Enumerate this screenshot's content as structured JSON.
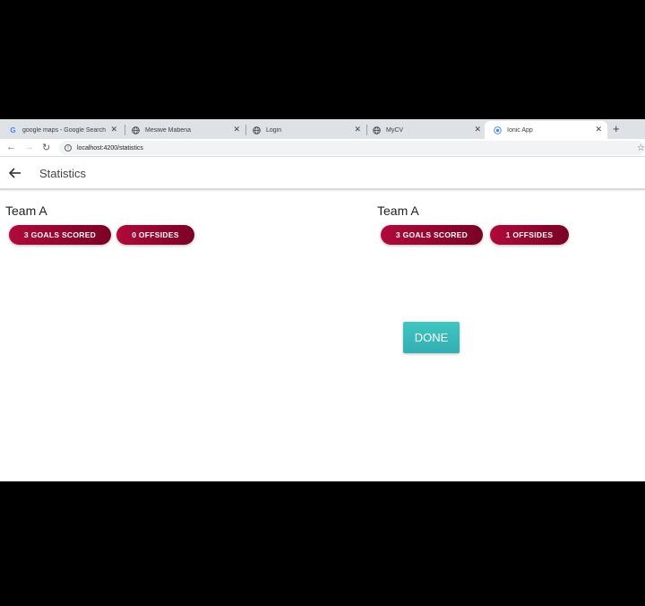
{
  "browser": {
    "tabs": [
      {
        "title": "google maps - Google Search",
        "favicon": "G"
      },
      {
        "title": "Mesiwe Mabena",
        "favicon": "globe"
      },
      {
        "title": "Login",
        "favicon": "globe"
      },
      {
        "title": "MyCV",
        "favicon": "globe"
      },
      {
        "title": "Ionic App",
        "favicon": "ionic",
        "active": true
      }
    ],
    "url": "localhost:4200/statistics"
  },
  "header": {
    "title": "Statistics"
  },
  "teams": [
    {
      "name": "Team A",
      "goals_label": "3 GOALS SCORED",
      "offsides_label": "0 OFFSIDES"
    },
    {
      "name": "Team A",
      "goals_label": "3 GOALS SCORED",
      "offsides_label": "1 OFFSIDES"
    }
  ],
  "done_label": "DONE",
  "colors": {
    "chip_start": "#b00a3a",
    "chip_end": "#7a0224",
    "done_button": "#3bbcb8"
  }
}
